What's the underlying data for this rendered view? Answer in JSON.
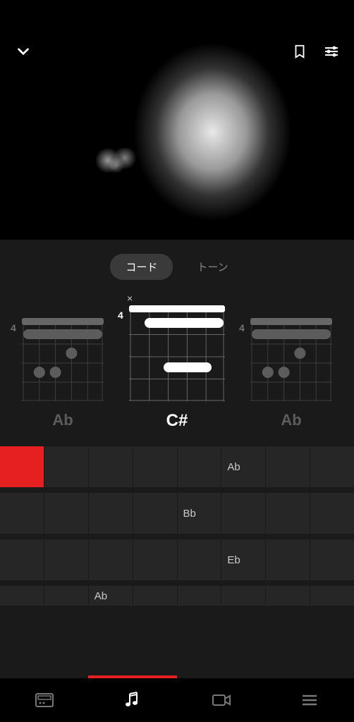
{
  "tabs": {
    "chord": "コード",
    "tone": "トーン"
  },
  "chords": {
    "left": {
      "fret": "4",
      "name": "Ab",
      "mute_pos": null
    },
    "center": {
      "fret": "4",
      "name": "C#",
      "mute": "×"
    },
    "right": {
      "fret": "4",
      "name": "Ab",
      "mute_pos": null
    }
  },
  "progress_rows": [
    {
      "cells": [
        "",
        "",
        "",
        "",
        "",
        "Ab",
        "",
        ""
      ],
      "playhead": true
    },
    {
      "cells": [
        "",
        "",
        "",
        "",
        "Bb",
        "",
        "",
        ""
      ]
    },
    {
      "cells": [
        "",
        "",
        "",
        "",
        "",
        "Eb",
        "",
        ""
      ]
    },
    {
      "cells": [
        "",
        "",
        "Ab",
        "",
        "",
        "",
        "",
        ""
      ],
      "partial": true
    }
  ],
  "icons": {
    "collapse": "collapse",
    "bookmark": "bookmark",
    "settings": "settings",
    "amp": "amp",
    "music": "music",
    "video": "video",
    "menu": "menu"
  }
}
